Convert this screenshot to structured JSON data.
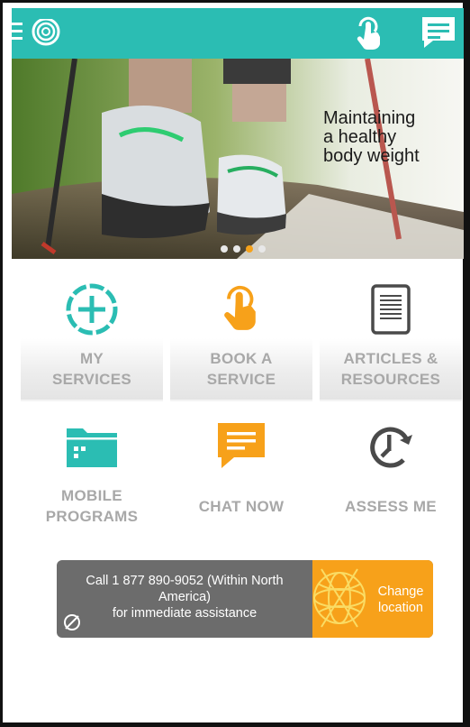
{
  "colors": {
    "brand_teal": "#2bbdb3",
    "accent_orange": "#f7a11a",
    "tile_label_gray": "#a8a8a8",
    "call_bar_gray": "#6c6c6c"
  },
  "topbar": {
    "icons": [
      "menu-icon",
      "logo-ring-icon",
      "tap-hand-icon",
      "chat-icon"
    ]
  },
  "banner": {
    "headline": "Maintaining\na healthy\nbody weight",
    "slide_count": 4,
    "active_slide": 3
  },
  "tiles": [
    {
      "label": "MY\nSERVICES",
      "icon": "plus-circle-icon"
    },
    {
      "label": "BOOK A\nSERVICE",
      "icon": "tap-hand-icon"
    },
    {
      "label": "ARTICLES &\nRESOURCES",
      "icon": "document-icon"
    },
    {
      "label": "MOBILE\nPROGRAMS",
      "icon": "folder-icon"
    },
    {
      "label": "CHAT NOW",
      "icon": "chat-bubble-icon"
    },
    {
      "label": "ASSESS ME",
      "icon": "clock-arrow-icon"
    }
  ],
  "call_bar": {
    "line1": "Call 1 877 890-9052 (Within North",
    "line2": "America)",
    "line3": "for immediate assistance",
    "change_location": "Change\nlocation"
  }
}
